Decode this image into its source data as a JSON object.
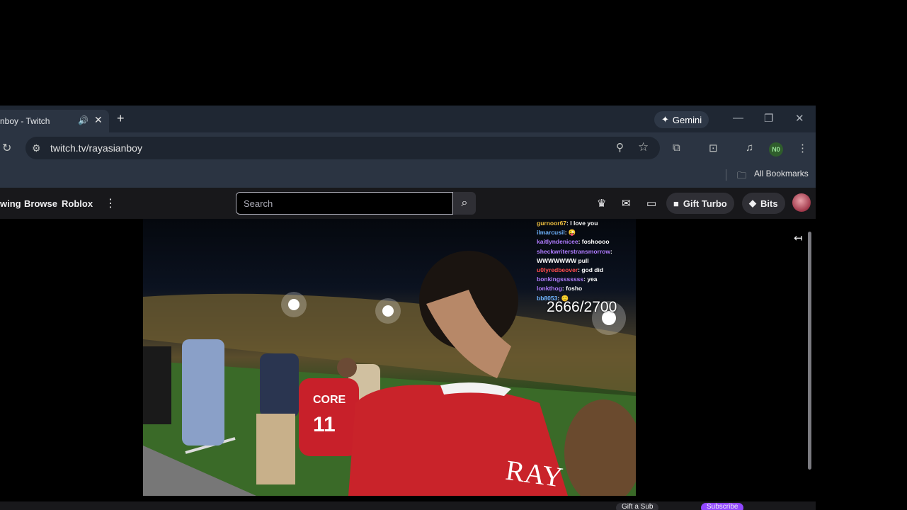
{
  "browser": {
    "tab_title": "nboy - Twitch",
    "gemini_label": "Gemini",
    "url": "twitch.tv/rayasianboy",
    "profile_initials": "N0",
    "bookmarks_label": "All Bookmarks"
  },
  "twitch": {
    "nav": [
      "wing",
      "Browse",
      "Roblox"
    ],
    "search_placeholder": "Search",
    "gift_turbo": "Gift Turbo",
    "bits": "Bits"
  },
  "stream": {
    "chat": [
      {
        "user": "gurnoor67",
        "message": "I love you",
        "color": "#f0c040"
      },
      {
        "user": "ilmarcusil",
        "message": "",
        "color": "#6fb4ff"
      },
      {
        "user": "kaitlyndenicee",
        "message": "foshoooo",
        "color": "#b07cff"
      },
      {
        "user": "sheckwriterstransmorrow",
        "message": "",
        "color": "#b07cff"
      },
      {
        "user": "WWWWWWW",
        "message": "pull",
        "color": "#ffffff"
      },
      {
        "user": "u0lyredbeover",
        "message": "god did",
        "color": "#ff4d4d"
      },
      {
        "user": "bonkingsssssss",
        "message": "yea",
        "color": "#b07cff"
      },
      {
        "user": "lonkthog",
        "message": "fosho",
        "color": "#b07cff"
      },
      {
        "user": "bb8053",
        "message": "",
        "color": "#6fb4ff"
      }
    ],
    "counter": "2666/2700",
    "jersey_name": "RAY",
    "jersey_number": "11"
  },
  "bottom_bar": {
    "gift_sub": "Gift a Sub",
    "subscribe": "Subscribe"
  }
}
